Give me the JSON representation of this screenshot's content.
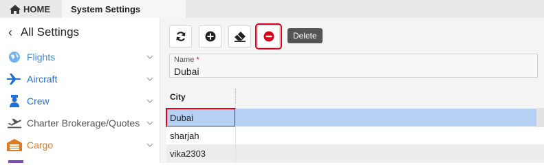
{
  "tabs": {
    "home_label": "HOME",
    "settings_label": "System Settings"
  },
  "sidebar": {
    "header": "All Settings",
    "items": [
      {
        "label": "Flights",
        "icon": "globe-icon",
        "color": "#3a8fd8"
      },
      {
        "label": "Aircraft",
        "icon": "airplane-icon",
        "color": "#1f6fd6"
      },
      {
        "label": "Crew",
        "icon": "crew-icon",
        "color": "#1f6fd6"
      },
      {
        "label": "Charter Brokerage/Quotes",
        "icon": "plane-departure-icon",
        "color": "#555555"
      },
      {
        "label": "Cargo",
        "icon": "warehouse-icon",
        "color": "#e07a1f"
      }
    ]
  },
  "toolbar": {
    "refresh_icon": "refresh-icon",
    "add_icon": "add-icon",
    "erase_icon": "eraser-icon",
    "delete_icon": "delete-icon",
    "delete_tooltip": "Delete"
  },
  "form": {
    "name_label": "Name",
    "name_required_mark": "*",
    "name_value": "Dubai"
  },
  "grid": {
    "column_header": "City",
    "rows": [
      "Dubai",
      "sharjah",
      "vika2303"
    ]
  },
  "colors": {
    "accent_red": "#e0001b",
    "selection_blue": "#b5d0f2",
    "delete_red": "#d9001b"
  }
}
